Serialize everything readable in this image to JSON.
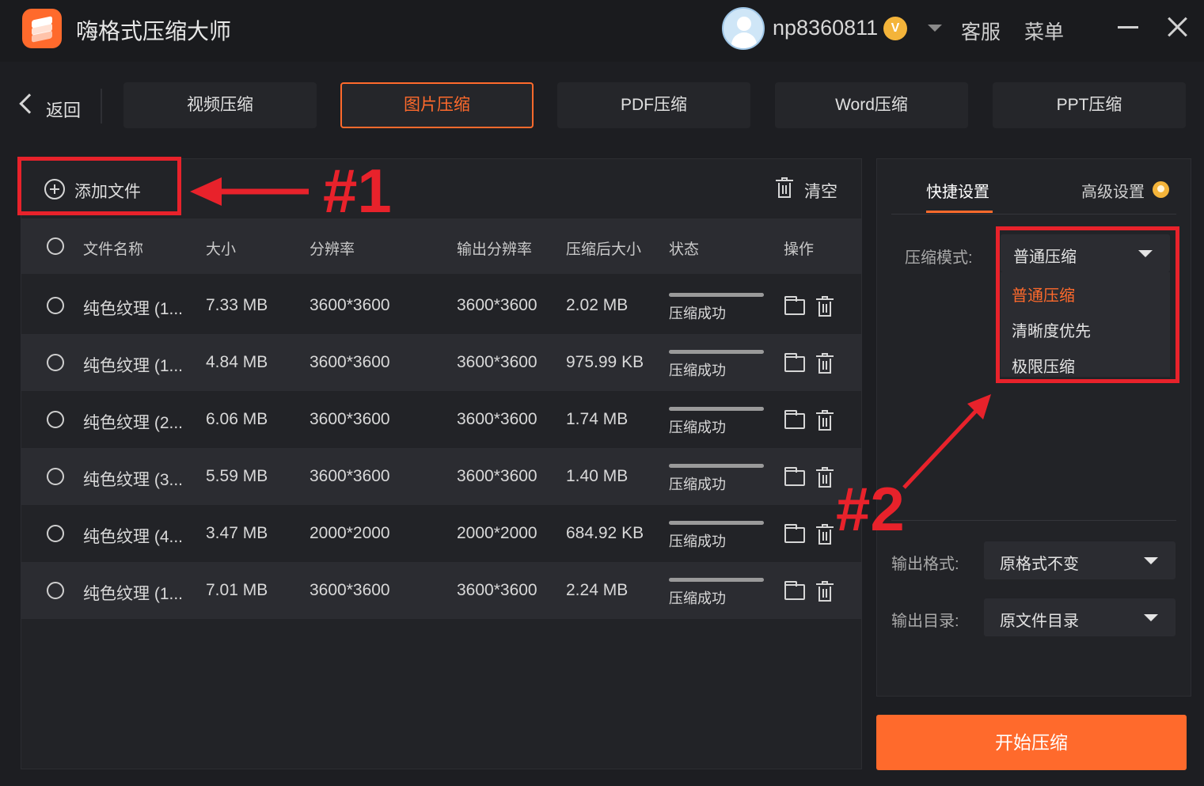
{
  "titlebar": {
    "app_title": "嗨格式压缩大师",
    "username": "np8360811",
    "vip_badge": "V",
    "customer_service": "客服",
    "menu": "菜单"
  },
  "nav": {
    "back_label": "返回",
    "tabs": [
      {
        "label": "视频压缩",
        "active": false
      },
      {
        "label": "图片压缩",
        "active": true
      },
      {
        "label": "PDF压缩",
        "active": false
      },
      {
        "label": "Word压缩",
        "active": false
      },
      {
        "label": "PPT压缩",
        "active": false
      }
    ]
  },
  "toolbar": {
    "add_file": "添加文件",
    "clear": "清空"
  },
  "annotations": {
    "label1": "#1",
    "label2": "#2"
  },
  "table": {
    "headers": {
      "name": "文件名称",
      "size": "大小",
      "resolution": "分辨率",
      "output_resolution": "输出分辨率",
      "compressed_size": "压缩后大小",
      "status": "状态",
      "actions": "操作"
    },
    "rows": [
      {
        "name": "纯色纹理 (1...",
        "size": "7.33 MB",
        "resolution": "3600*3600",
        "output_resolution": "3600*3600",
        "compressed_size": "2.02 MB",
        "status": "压缩成功",
        "progress": 1.0
      },
      {
        "name": "纯色纹理 (1...",
        "size": "4.84 MB",
        "resolution": "3600*3600",
        "output_resolution": "3600*3600",
        "compressed_size": "975.99 KB",
        "status": "压缩成功",
        "progress": 1.0
      },
      {
        "name": "纯色纹理 (2...",
        "size": "6.06 MB",
        "resolution": "3600*3600",
        "output_resolution": "3600*3600",
        "compressed_size": "1.74 MB",
        "status": "压缩成功",
        "progress": 1.0
      },
      {
        "name": "纯色纹理 (3...",
        "size": "5.59 MB",
        "resolution": "3600*3600",
        "output_resolution": "3600*3600",
        "compressed_size": "1.40 MB",
        "status": "压缩成功",
        "progress": 1.0
      },
      {
        "name": "纯色纹理 (4...",
        "size": "3.47 MB",
        "resolution": "2000*2000",
        "output_resolution": "2000*2000",
        "compressed_size": "684.92 KB",
        "status": "压缩成功",
        "progress": 1.0
      },
      {
        "name": "纯色纹理 (1...",
        "size": "7.01 MB",
        "resolution": "3600*3600",
        "output_resolution": "3600*3600",
        "compressed_size": "2.24 MB",
        "status": "压缩成功",
        "progress": 1.0
      }
    ]
  },
  "settings": {
    "tab_quick": "快捷设置",
    "tab_advanced": "高级设置",
    "mode_label": "压缩模式:",
    "mode_value": "普通压缩",
    "mode_options": [
      "普通压缩",
      "清晰度优先",
      "极限压缩"
    ],
    "format_label": "输出格式:",
    "format_value": "原格式不变",
    "dir_label": "输出目录:",
    "dir_value": "原文件目录",
    "start_button": "开始压缩"
  },
  "colors": {
    "accent": "#ff6a2c",
    "annotation": "#e8222b",
    "background": "#1d1e22",
    "panel": "#222327"
  }
}
